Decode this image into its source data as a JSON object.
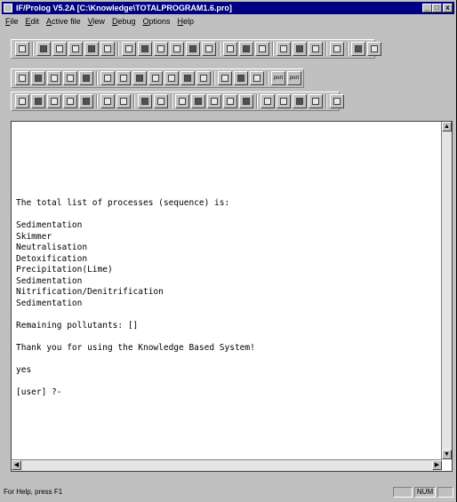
{
  "window": {
    "title": "IF/Prolog V5.2A  [C:\\Knowledge\\TOTALPROGRAM1.6.pro]",
    "minimize_glyph": "_",
    "maximize_glyph": "□",
    "close_glyph": "x"
  },
  "menu": [
    "File",
    "Edit",
    "Active file",
    "View",
    "Debug",
    "Options",
    "Help"
  ],
  "toolbar_icons": {
    "row1": [
      "new-file-icon",
      "open-file-icon",
      "open-folder-icon",
      "save-file-icon",
      "consult-icon",
      "cut-icon",
      "edit-icon",
      "open-icon",
      "open-folder-icon",
      "save-icon",
      "cut-icon",
      "edit-icon",
      "find-icon",
      "window-icon",
      "copy-icon",
      "paste-icon",
      "print-icon",
      "grid-icon",
      "stop-icon",
      "pause-icon",
      "help-icon"
    ],
    "row2": [
      "trace-icon",
      "text-icon",
      "module-icon",
      "browse-icon",
      "watch-icon",
      "breakpoint-icon",
      "step-in-icon",
      "step-over-icon",
      "step-out-icon",
      "skip-icon",
      "leap-icon",
      "creep-icon",
      "table-icon",
      "table-icon",
      "table-icon",
      "port-icon",
      "port-icon"
    ],
    "row3": [
      "calc-icon",
      "grid-icon",
      "list-icon",
      "edit-list-icon",
      "select-icon",
      "align-icon",
      "arrange-icon",
      "tile-icon",
      "cascade-icon",
      "arrow-left-icon",
      "arrow-right-icon",
      "arrow-left-icon",
      "arrow-right-icon",
      "frame-icon",
      "arrow-down-icon",
      "arrow-down-icon",
      "arrow-up-icon",
      "arrow-up-icon",
      "pencil-icon"
    ],
    "row2_port_label": "port"
  },
  "console": {
    "lines": [
      "The total list of processes (sequence) is:",
      "",
      "Sedimentation",
      "Skimmer",
      "Neutralisation",
      "Detoxification",
      "Precipitation(Lime)",
      "Sedimentation",
      "Nitrification/Denitrification",
      "Sedimentation",
      "",
      "Remaining pollutants: []",
      "",
      "Thank you for using the Knowledge Based System!",
      "",
      "yes",
      "",
      "[user] ?-"
    ]
  },
  "statusbar": {
    "message": "For Help, press F1",
    "num_indicator": "NUM"
  }
}
